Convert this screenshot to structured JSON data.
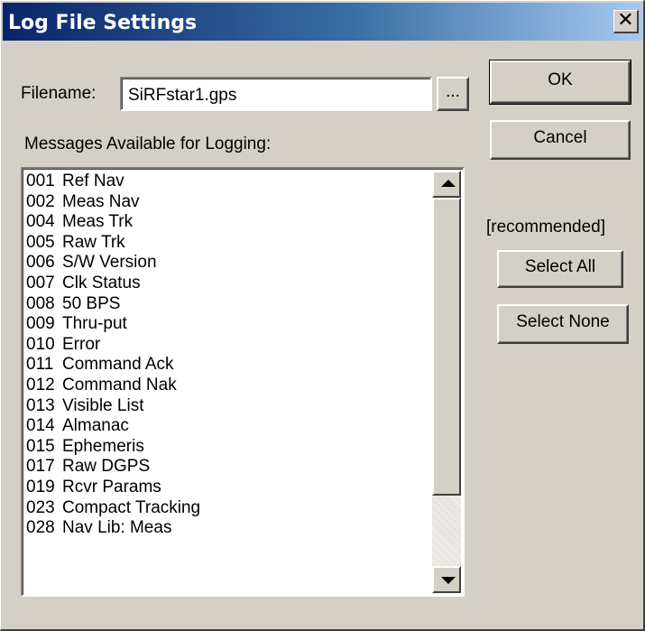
{
  "window": {
    "title": "Log File Settings",
    "close_glyph": "✕",
    "close_icon": "close-icon"
  },
  "filename": {
    "label": "Filename:",
    "value": "SiRFstar1.gps",
    "browse_label": "..."
  },
  "messages": {
    "label": "Messages Available for Logging:",
    "items": [
      {
        "code": "001",
        "name": "Ref Nav"
      },
      {
        "code": "002",
        "name": "Meas Nav"
      },
      {
        "code": "004",
        "name": "Meas Trk"
      },
      {
        "code": "005",
        "name": "Raw Trk"
      },
      {
        "code": "006",
        "name": "S/W Version"
      },
      {
        "code": "007",
        "name": "Clk Status"
      },
      {
        "code": "008",
        "name": "50 BPS"
      },
      {
        "code": "009",
        "name": "Thru-put"
      },
      {
        "code": "010",
        "name": "Error"
      },
      {
        "code": "011",
        "name": "Command Ack"
      },
      {
        "code": "012",
        "name": "Command Nak"
      },
      {
        "code": "013",
        "name": "Visible List"
      },
      {
        "code": "014",
        "name": "Almanac"
      },
      {
        "code": "015",
        "name": "Ephemeris"
      },
      {
        "code": "017",
        "name": "Raw DGPS"
      },
      {
        "code": "019",
        "name": "Rcvr Params"
      },
      {
        "code": "023",
        "name": "Compact Tracking"
      },
      {
        "code": "028",
        "name": "Nav Lib: Meas"
      }
    ],
    "scroll_up_icon": "scroll-up-arrow-icon",
    "scroll_down_icon": "scroll-down-arrow-icon"
  },
  "buttons": {
    "ok": "OK",
    "cancel": "Cancel",
    "recommended_note": "[recommended]",
    "select_all": "Select All",
    "select_none": "Select None"
  },
  "colors": {
    "titlebar_start": "#0a246a",
    "titlebar_end": "#a6caf0",
    "face": "#d4d0c8"
  }
}
